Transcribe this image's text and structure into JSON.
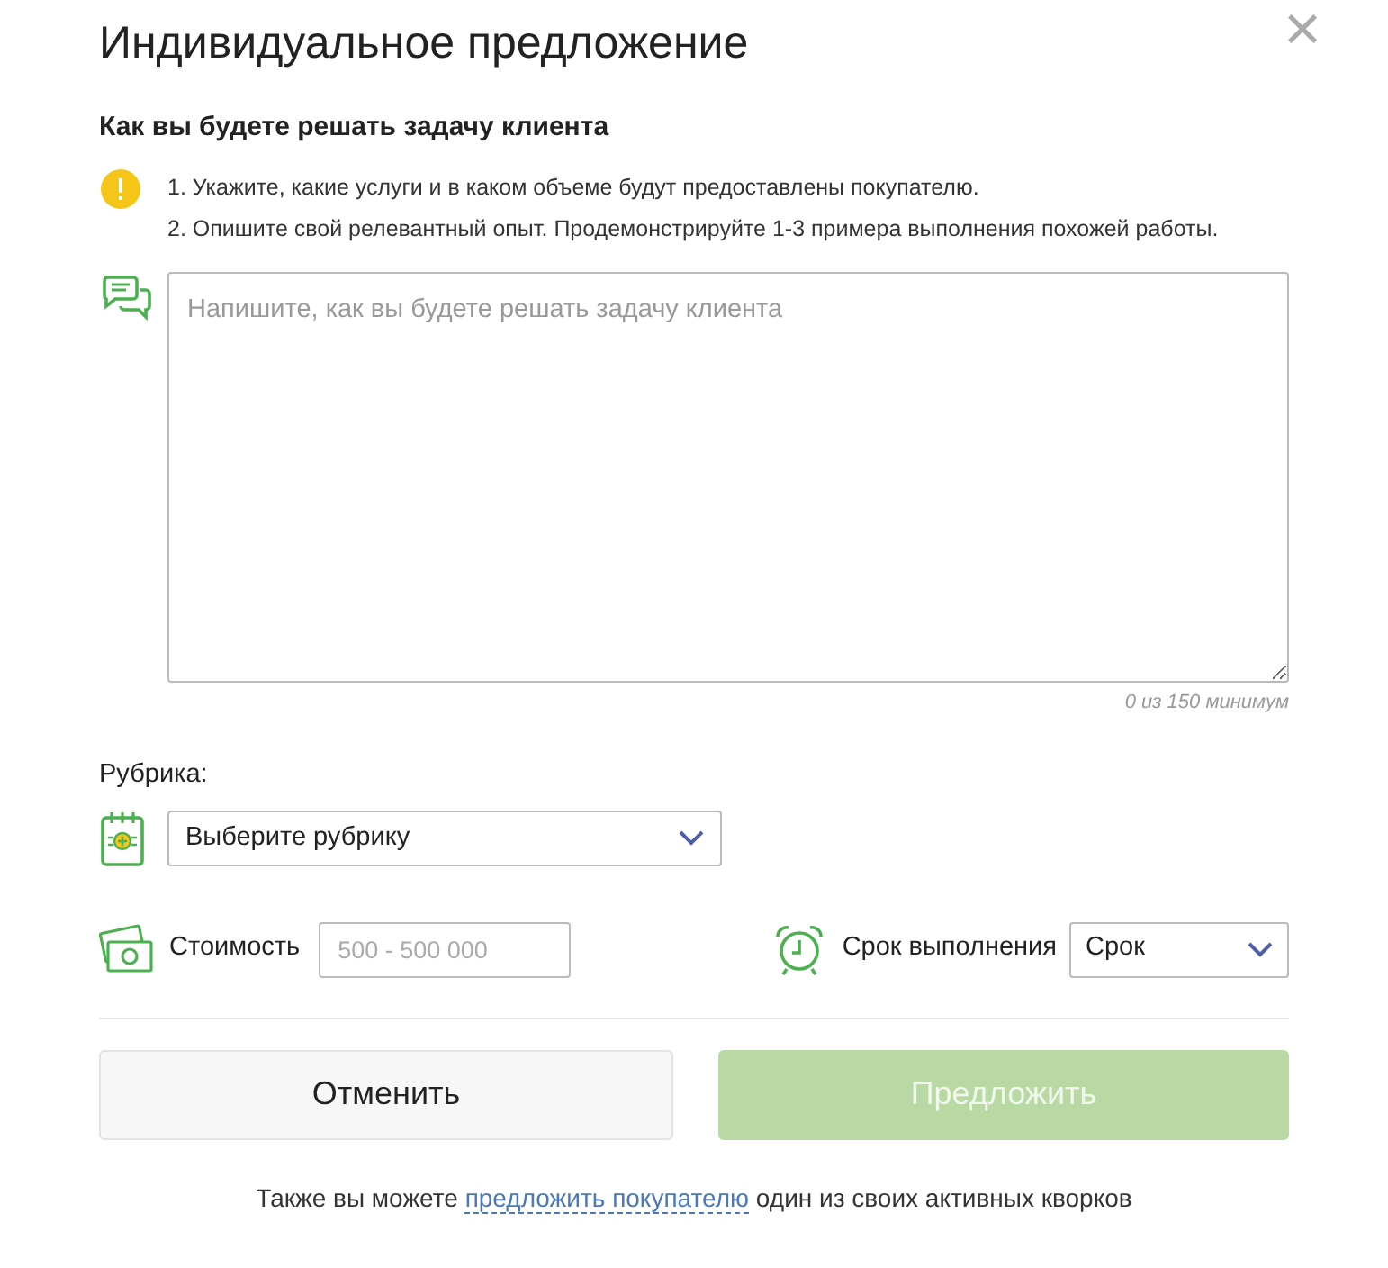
{
  "title": "Индивидуальное предложение",
  "close": "×",
  "section_title": "Как вы будете решать задачу клиента",
  "hints": [
    "1. Укажите, какие услуги и в каком объеме будут предоставлены покупателю.",
    "2. Опишите свой релевантный опыт. Продемонстрируйте 1-3 примера выполнения похожей работы."
  ],
  "description": {
    "placeholder": "Напишите, как вы будете решать задачу клиента",
    "counter": "0 из 150 минимум"
  },
  "category": {
    "label": "Рубрика:",
    "value": "Выберите рубрику"
  },
  "price": {
    "label": "Стоимость",
    "placeholder": "500 - 500 000"
  },
  "deadline": {
    "label": "Срок выполнения",
    "value": "Срок"
  },
  "buttons": [
    {
      "kind": "cancel",
      "label": "Отменить",
      "disabled": false
    },
    {
      "kind": "submit",
      "label": "Предложить",
      "disabled": true
    }
  ],
  "footer": {
    "before": "Также вы можете",
    "link": "предложить покупателю",
    "after": "один из своих активных кворков"
  }
}
